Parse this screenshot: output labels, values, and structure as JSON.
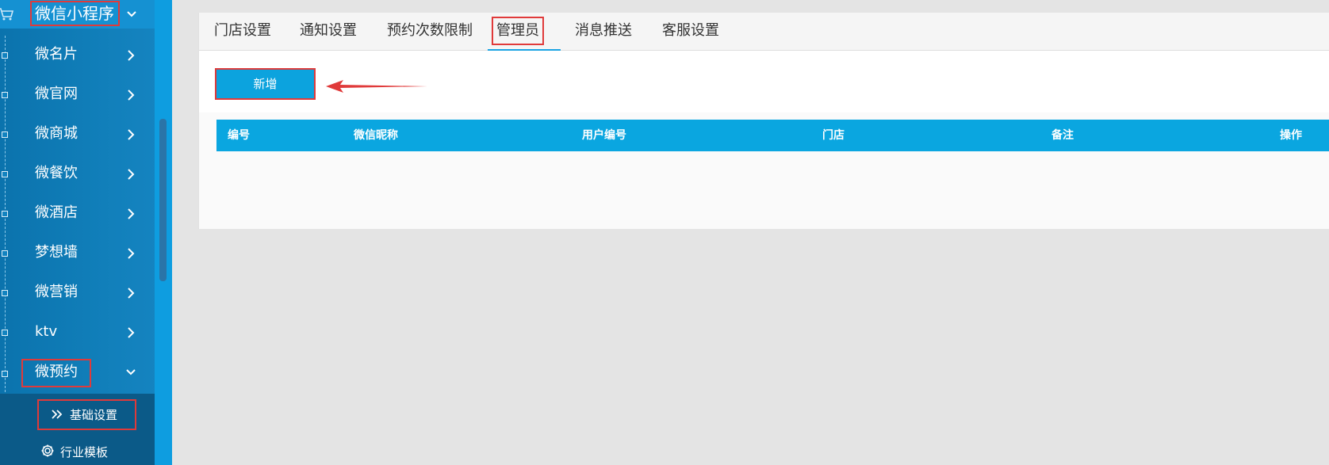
{
  "sidebar": {
    "app_title": "微信小程序",
    "items": [
      {
        "label": "微名片"
      },
      {
        "label": "微官网"
      },
      {
        "label": "微商城"
      },
      {
        "label": "微餐饮"
      },
      {
        "label": "微酒店"
      },
      {
        "label": "梦想墙"
      },
      {
        "label": "微营销"
      },
      {
        "label": "ktv"
      },
      {
        "label": "微预约"
      }
    ],
    "sub_items": [
      {
        "label": "基础设置"
      },
      {
        "label": "行业模板"
      }
    ]
  },
  "tabs": [
    {
      "label": "门店设置"
    },
    {
      "label": "通知设置"
    },
    {
      "label": "预约次数限制"
    },
    {
      "label": "管理员"
    },
    {
      "label": "消息推送"
    },
    {
      "label": "客服设置"
    }
  ],
  "toolbar": {
    "add_label": "新增"
  },
  "table": {
    "columns": [
      "编号",
      "微信昵称",
      "用户编号",
      "门店",
      "备注",
      "操作"
    ]
  },
  "colors": {
    "accent": "#0ca3de",
    "highlight_box": "#e03a3a",
    "sidebar_bg": "#117fba"
  }
}
